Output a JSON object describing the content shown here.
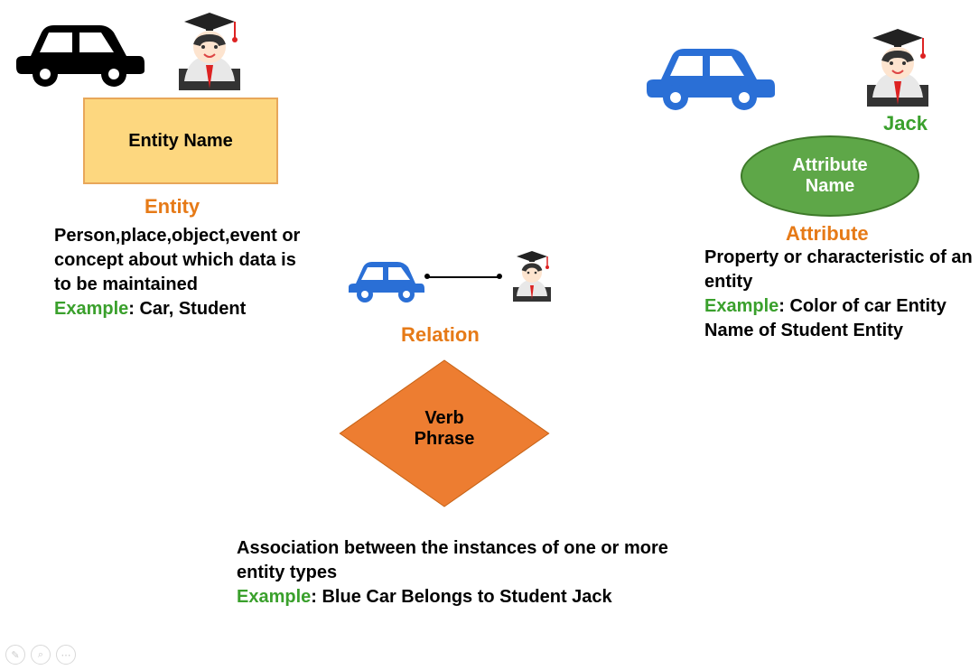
{
  "entity": {
    "shape_label": "Entity Name",
    "title": "Entity",
    "description": "Person,place,object,event or concept about which data is to be maintained",
    "example_label": "Example",
    "example_text": ": Car, Student"
  },
  "relation": {
    "shape_label": "Verb Phrase",
    "title": "Relation",
    "description": "Association between the instances of one or more entity types",
    "example_label": "Example",
    "example_text": ": Blue Car Belongs to Student Jack"
  },
  "attribute": {
    "shape_label": "Attribute Name",
    "title": "Attribute",
    "jack_label": "Jack",
    "description": "Property or characteristic of an entity",
    "example_label": "Example",
    "example_text": ": Color of car Entity Name of Student Entity"
  },
  "icons": {
    "car_black": "car-icon",
    "car_blue": "car-icon",
    "student": "student-icon"
  }
}
